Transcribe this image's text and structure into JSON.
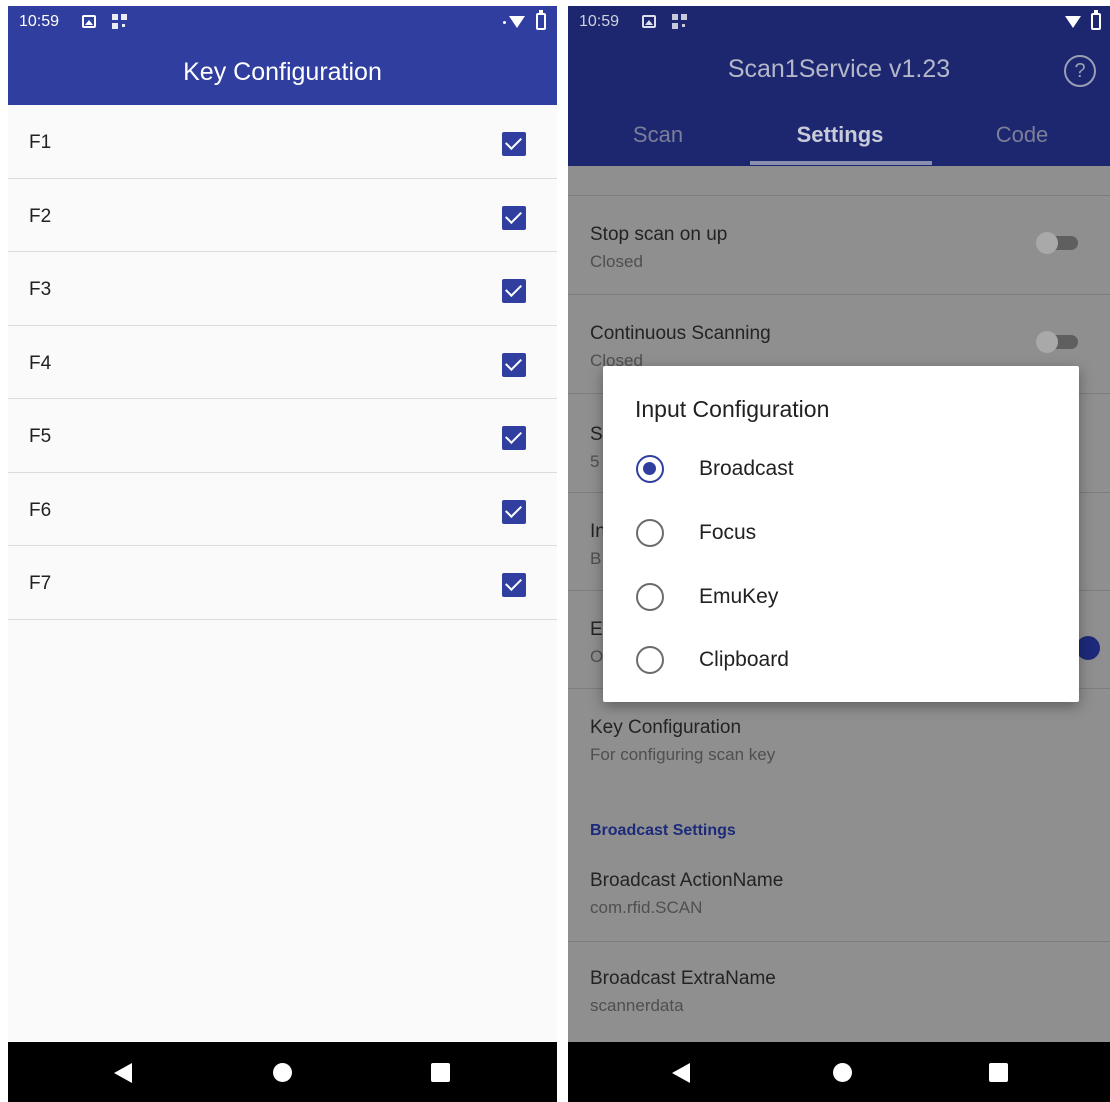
{
  "left": {
    "status_time": "10:59",
    "title": "Key Configuration",
    "keys": [
      {
        "label": "F1",
        "checked": true
      },
      {
        "label": "F2",
        "checked": true
      },
      {
        "label": "F3",
        "checked": true
      },
      {
        "label": "F4",
        "checked": true
      },
      {
        "label": "F5",
        "checked": true
      },
      {
        "label": "F6",
        "checked": true
      },
      {
        "label": "F7",
        "checked": true
      }
    ]
  },
  "right": {
    "status_time": "10:59",
    "title": "Scan1Service v1.23",
    "help_icon": "?",
    "tabs": [
      "Scan",
      "Settings",
      "Code"
    ],
    "active_tab": "Settings",
    "prefs": {
      "stop_scan": {
        "title": "Stop scan on up",
        "summary": "Closed"
      },
      "continuous": {
        "title": "Continuous Scanning",
        "summary": "Closed"
      },
      "partial_1": {
        "title": "S",
        "summary": "5"
      },
      "partial_2": {
        "title": "In",
        "summary": "B"
      },
      "partial_3": {
        "title": "E",
        "summary": "O"
      },
      "key_config": {
        "title": "Key Configuration",
        "summary": "For configuring scan key"
      },
      "section": "Broadcast Settings",
      "action_name": {
        "title": "Broadcast ActionName",
        "summary": "com.rfid.SCAN"
      },
      "extra_name": {
        "title": "Broadcast ExtraName",
        "summary": "scannerdata"
      }
    },
    "dialog": {
      "title": "Input Configuration",
      "options": [
        "Broadcast",
        "Focus",
        "EmuKey",
        "Clipboard"
      ],
      "selected": "Broadcast"
    }
  },
  "colors": {
    "primary": "#303f9f",
    "primary_dimmed": "#1c2770",
    "nav_bar": "#000000"
  },
  "icons": [
    "image-icon",
    "qr-icon",
    "wifi-icon",
    "battery-icon",
    "help-icon",
    "back-icon",
    "home-icon",
    "recents-icon",
    "checkbox-icon",
    "radio-icon",
    "switch-icon"
  ]
}
